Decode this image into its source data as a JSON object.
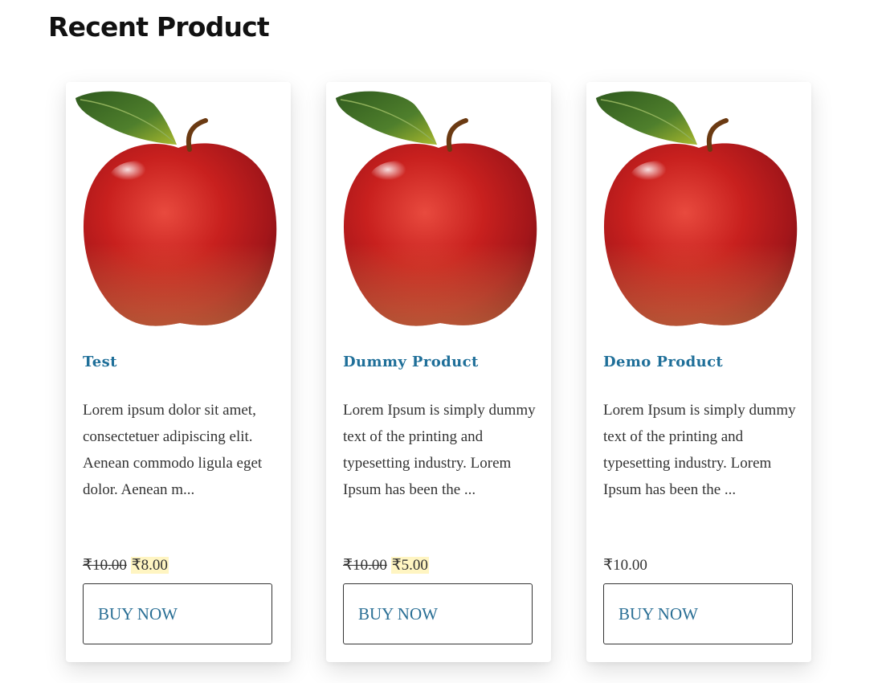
{
  "section": {
    "title": "Recent Product"
  },
  "products": [
    {
      "name": "Test",
      "description": "Lorem ipsum dolor sit amet, consectetuer adipiscing elit. Aenean commodo ligula eget dolor. Aenean m...",
      "old_price": "₹10.00",
      "price": "₹8.00",
      "button_label": "BUY NOW",
      "image": "red-apple-image"
    },
    {
      "name": "Dummy Product",
      "description": "Lorem Ipsum is simply dummy text of the printing and typesetting industry. Lorem Ipsum has been the ...",
      "old_price": "₹10.00",
      "price": "₹5.00",
      "button_label": "BUY NOW",
      "image": "red-apple-image"
    },
    {
      "name": "Demo Product",
      "description": "Lorem Ipsum is simply dummy text of the printing and typesetting industry. Lorem Ipsum has been the ...",
      "price": "₹10.00",
      "button_label": "BUY NOW",
      "image": "red-apple-image"
    }
  ],
  "colors": {
    "title_link": "#1f6f99",
    "button_text": "#2a6f95",
    "sale_highlight": "#fff5c2"
  }
}
